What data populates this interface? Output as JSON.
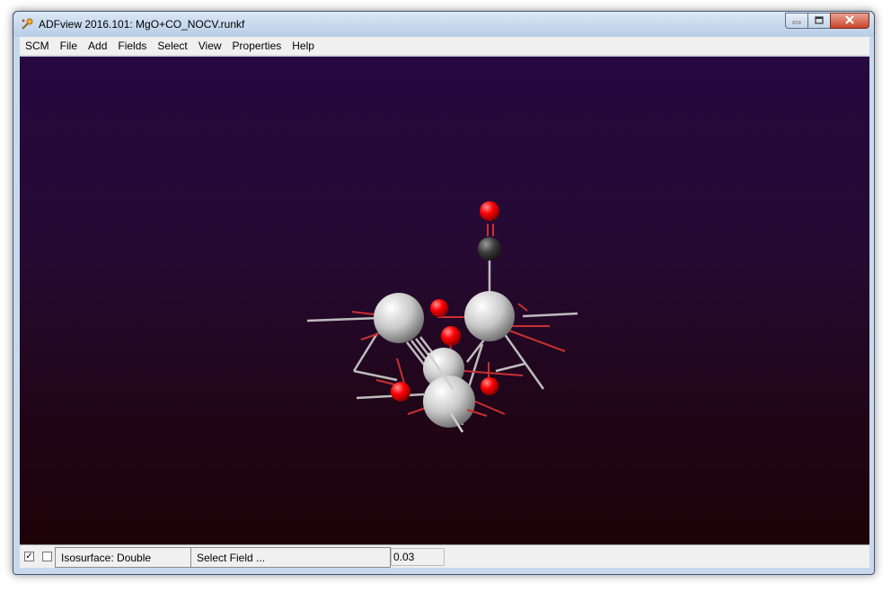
{
  "window": {
    "title": "ADFview 2016.101: MgO+CO_NOCV.runkf"
  },
  "menu": {
    "items": [
      "SCM",
      "File",
      "Add",
      "Fields",
      "Select",
      "View",
      "Properties",
      "Help"
    ]
  },
  "statusbar": {
    "isosurface_label": "Isosurface: Double",
    "field_selector_label": "Select Field ...",
    "isovalue": "0.03",
    "checkbox_1_checked": true,
    "checkbox_2_checked": false
  },
  "colors": {
    "background_top": "#270840",
    "background_bottom": "#1d0208",
    "atom_mg": "#e6e6e6",
    "atom_o": "#ff0000",
    "atom_c": "#3c3c3c"
  },
  "icons": {
    "app": "adfview-app-icon",
    "minimize": "minimize-icon",
    "maximize": "maximize-icon",
    "close": "close-icon"
  }
}
